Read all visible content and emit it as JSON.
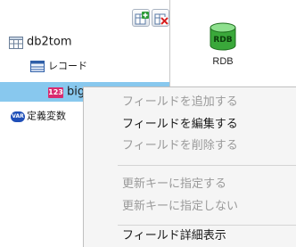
{
  "toolbar": {
    "add_icon": "add-table-icon",
    "delete_icon": "delete-table-icon"
  },
  "tree": {
    "root": {
      "label": "db2tom",
      "icon": "table-icon"
    },
    "record": {
      "label": "レコード",
      "icon": "record-icon"
    },
    "field": {
      "label": "big",
      "icon": "numeric-field-icon",
      "badge": "123"
    },
    "variable": {
      "label": "定義変数",
      "icon": "variable-icon",
      "badge": "VAR"
    }
  },
  "right_panel": {
    "item_label": "RDB",
    "icon_text": "RDB"
  },
  "context_menu": {
    "items": [
      {
        "label": "フィールドを追加する",
        "enabled": false
      },
      {
        "label": "フィールドを編集する",
        "enabled": true
      },
      {
        "label": "フィールドを削除する",
        "enabled": false
      },
      {
        "label": "更新キーに指定する",
        "enabled": false
      },
      {
        "label": "更新キーに指定しない",
        "enabled": false
      },
      {
        "label": "フィールド詳細表示",
        "enabled": true
      }
    ]
  },
  "colors": {
    "selection": "#88c8ee",
    "menu_bg": "#f5f5f5",
    "disabled_text": "#9a9a9a"
  }
}
